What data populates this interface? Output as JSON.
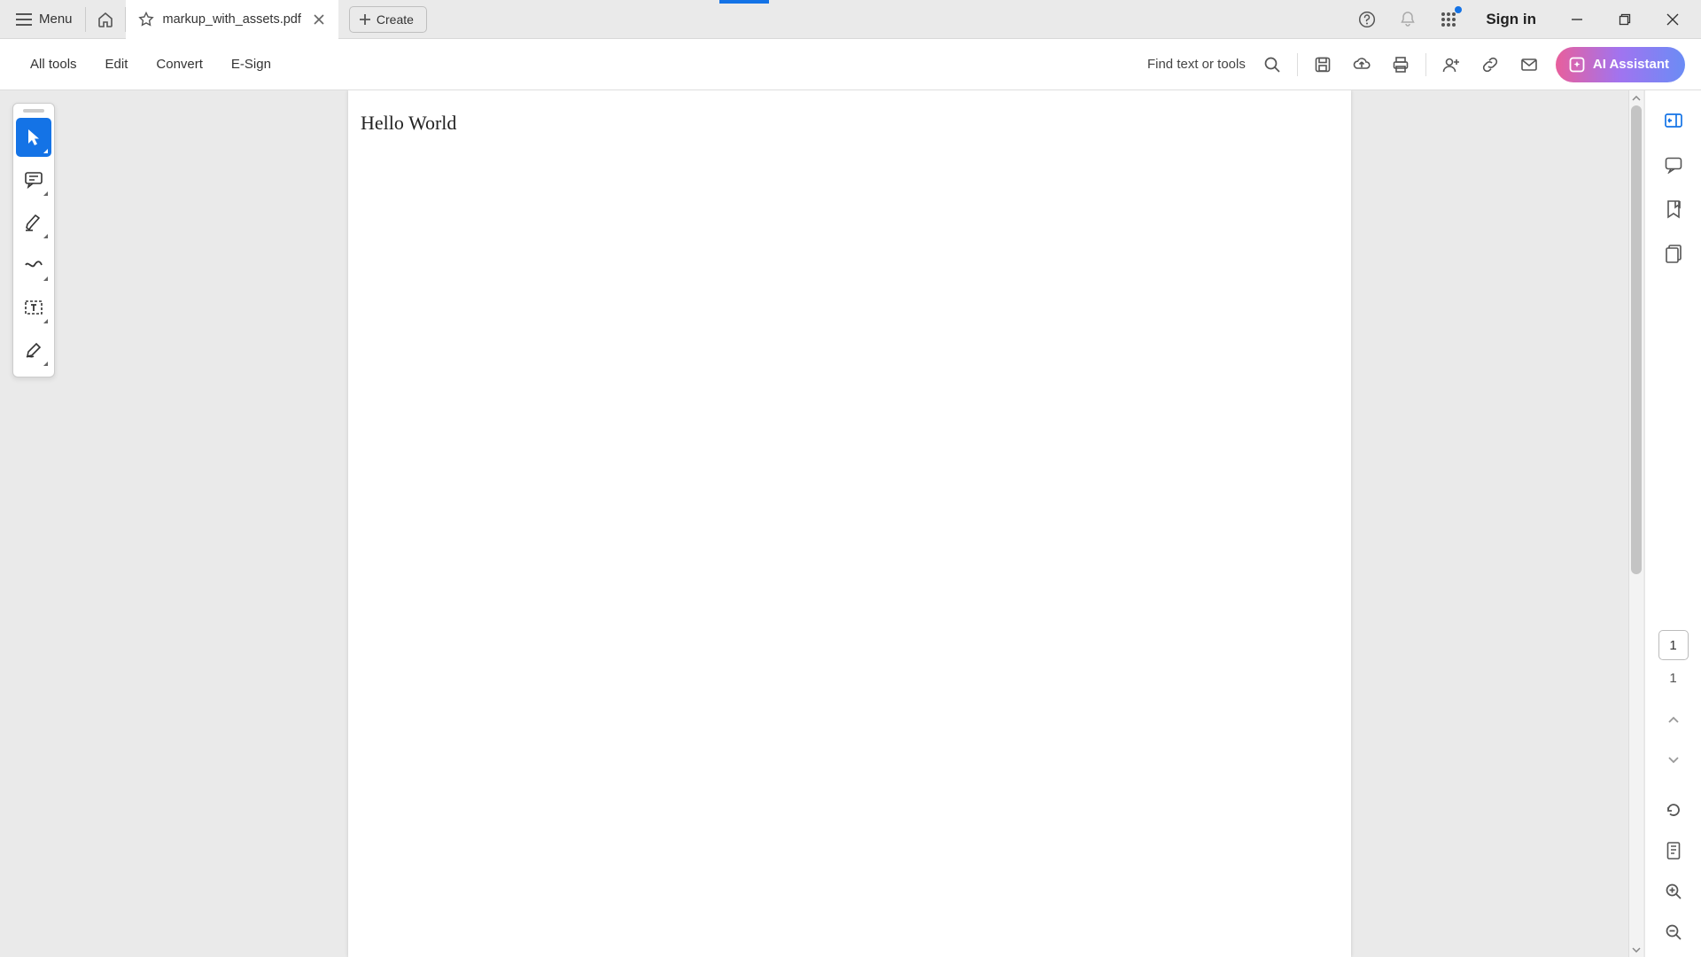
{
  "titlebar": {
    "menu_label": "Menu",
    "tab": {
      "title": "markup_with_assets.pdf"
    },
    "create_label": "Create",
    "signin_label": "Sign in"
  },
  "toolbar": {
    "all_tools": "All tools",
    "edit": "Edit",
    "convert": "Convert",
    "esign": "E-Sign",
    "search_label": "Find text or tools",
    "ai_label": "AI Assistant"
  },
  "document": {
    "content": "Hello World"
  },
  "right_rail": {
    "current_page": "1",
    "total_pages": "1"
  },
  "colors": {
    "accent": "#1473e6"
  }
}
